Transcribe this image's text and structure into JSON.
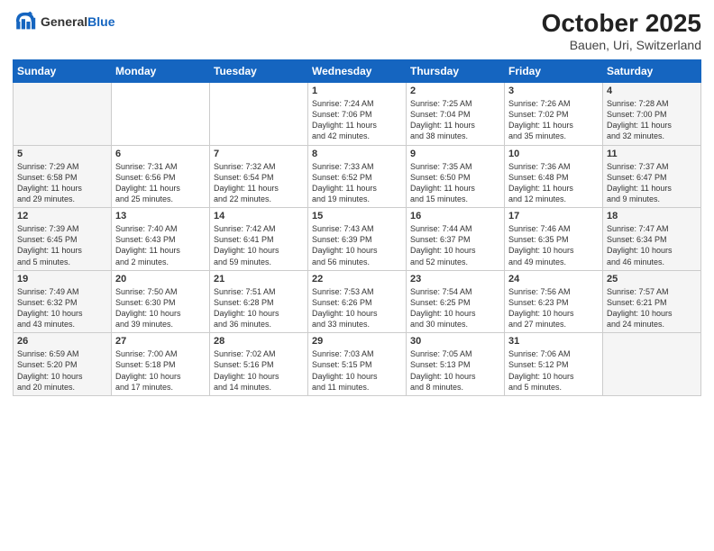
{
  "header": {
    "logo_general": "General",
    "logo_blue": "Blue",
    "title": "October 2025",
    "subtitle": "Bauen, Uri, Switzerland"
  },
  "weekdays": [
    "Sunday",
    "Monday",
    "Tuesday",
    "Wednesday",
    "Thursday",
    "Friday",
    "Saturday"
  ],
  "rows": [
    [
      {
        "day": "",
        "info": ""
      },
      {
        "day": "",
        "info": ""
      },
      {
        "day": "",
        "info": ""
      },
      {
        "day": "1",
        "info": "Sunrise: 7:24 AM\nSunset: 7:06 PM\nDaylight: 11 hours\nand 42 minutes."
      },
      {
        "day": "2",
        "info": "Sunrise: 7:25 AM\nSunset: 7:04 PM\nDaylight: 11 hours\nand 38 minutes."
      },
      {
        "day": "3",
        "info": "Sunrise: 7:26 AM\nSunset: 7:02 PM\nDaylight: 11 hours\nand 35 minutes."
      },
      {
        "day": "4",
        "info": "Sunrise: 7:28 AM\nSunset: 7:00 PM\nDaylight: 11 hours\nand 32 minutes."
      }
    ],
    [
      {
        "day": "5",
        "info": "Sunrise: 7:29 AM\nSunset: 6:58 PM\nDaylight: 11 hours\nand 29 minutes."
      },
      {
        "day": "6",
        "info": "Sunrise: 7:31 AM\nSunset: 6:56 PM\nDaylight: 11 hours\nand 25 minutes."
      },
      {
        "day": "7",
        "info": "Sunrise: 7:32 AM\nSunset: 6:54 PM\nDaylight: 11 hours\nand 22 minutes."
      },
      {
        "day": "8",
        "info": "Sunrise: 7:33 AM\nSunset: 6:52 PM\nDaylight: 11 hours\nand 19 minutes."
      },
      {
        "day": "9",
        "info": "Sunrise: 7:35 AM\nSunset: 6:50 PM\nDaylight: 11 hours\nand 15 minutes."
      },
      {
        "day": "10",
        "info": "Sunrise: 7:36 AM\nSunset: 6:48 PM\nDaylight: 11 hours\nand 12 minutes."
      },
      {
        "day": "11",
        "info": "Sunrise: 7:37 AM\nSunset: 6:47 PM\nDaylight: 11 hours\nand 9 minutes."
      }
    ],
    [
      {
        "day": "12",
        "info": "Sunrise: 7:39 AM\nSunset: 6:45 PM\nDaylight: 11 hours\nand 5 minutes."
      },
      {
        "day": "13",
        "info": "Sunrise: 7:40 AM\nSunset: 6:43 PM\nDaylight: 11 hours\nand 2 minutes."
      },
      {
        "day": "14",
        "info": "Sunrise: 7:42 AM\nSunset: 6:41 PM\nDaylight: 10 hours\nand 59 minutes."
      },
      {
        "day": "15",
        "info": "Sunrise: 7:43 AM\nSunset: 6:39 PM\nDaylight: 10 hours\nand 56 minutes."
      },
      {
        "day": "16",
        "info": "Sunrise: 7:44 AM\nSunset: 6:37 PM\nDaylight: 10 hours\nand 52 minutes."
      },
      {
        "day": "17",
        "info": "Sunrise: 7:46 AM\nSunset: 6:35 PM\nDaylight: 10 hours\nand 49 minutes."
      },
      {
        "day": "18",
        "info": "Sunrise: 7:47 AM\nSunset: 6:34 PM\nDaylight: 10 hours\nand 46 minutes."
      }
    ],
    [
      {
        "day": "19",
        "info": "Sunrise: 7:49 AM\nSunset: 6:32 PM\nDaylight: 10 hours\nand 43 minutes."
      },
      {
        "day": "20",
        "info": "Sunrise: 7:50 AM\nSunset: 6:30 PM\nDaylight: 10 hours\nand 39 minutes."
      },
      {
        "day": "21",
        "info": "Sunrise: 7:51 AM\nSunset: 6:28 PM\nDaylight: 10 hours\nand 36 minutes."
      },
      {
        "day": "22",
        "info": "Sunrise: 7:53 AM\nSunset: 6:26 PM\nDaylight: 10 hours\nand 33 minutes."
      },
      {
        "day": "23",
        "info": "Sunrise: 7:54 AM\nSunset: 6:25 PM\nDaylight: 10 hours\nand 30 minutes."
      },
      {
        "day": "24",
        "info": "Sunrise: 7:56 AM\nSunset: 6:23 PM\nDaylight: 10 hours\nand 27 minutes."
      },
      {
        "day": "25",
        "info": "Sunrise: 7:57 AM\nSunset: 6:21 PM\nDaylight: 10 hours\nand 24 minutes."
      }
    ],
    [
      {
        "day": "26",
        "info": "Sunrise: 6:59 AM\nSunset: 5:20 PM\nDaylight: 10 hours\nand 20 minutes."
      },
      {
        "day": "27",
        "info": "Sunrise: 7:00 AM\nSunset: 5:18 PM\nDaylight: 10 hours\nand 17 minutes."
      },
      {
        "day": "28",
        "info": "Sunrise: 7:02 AM\nSunset: 5:16 PM\nDaylight: 10 hours\nand 14 minutes."
      },
      {
        "day": "29",
        "info": "Sunrise: 7:03 AM\nSunset: 5:15 PM\nDaylight: 10 hours\nand 11 minutes."
      },
      {
        "day": "30",
        "info": "Sunrise: 7:05 AM\nSunset: 5:13 PM\nDaylight: 10 hours\nand 8 minutes."
      },
      {
        "day": "31",
        "info": "Sunrise: 7:06 AM\nSunset: 5:12 PM\nDaylight: 10 hours\nand 5 minutes."
      },
      {
        "day": "",
        "info": ""
      }
    ]
  ]
}
